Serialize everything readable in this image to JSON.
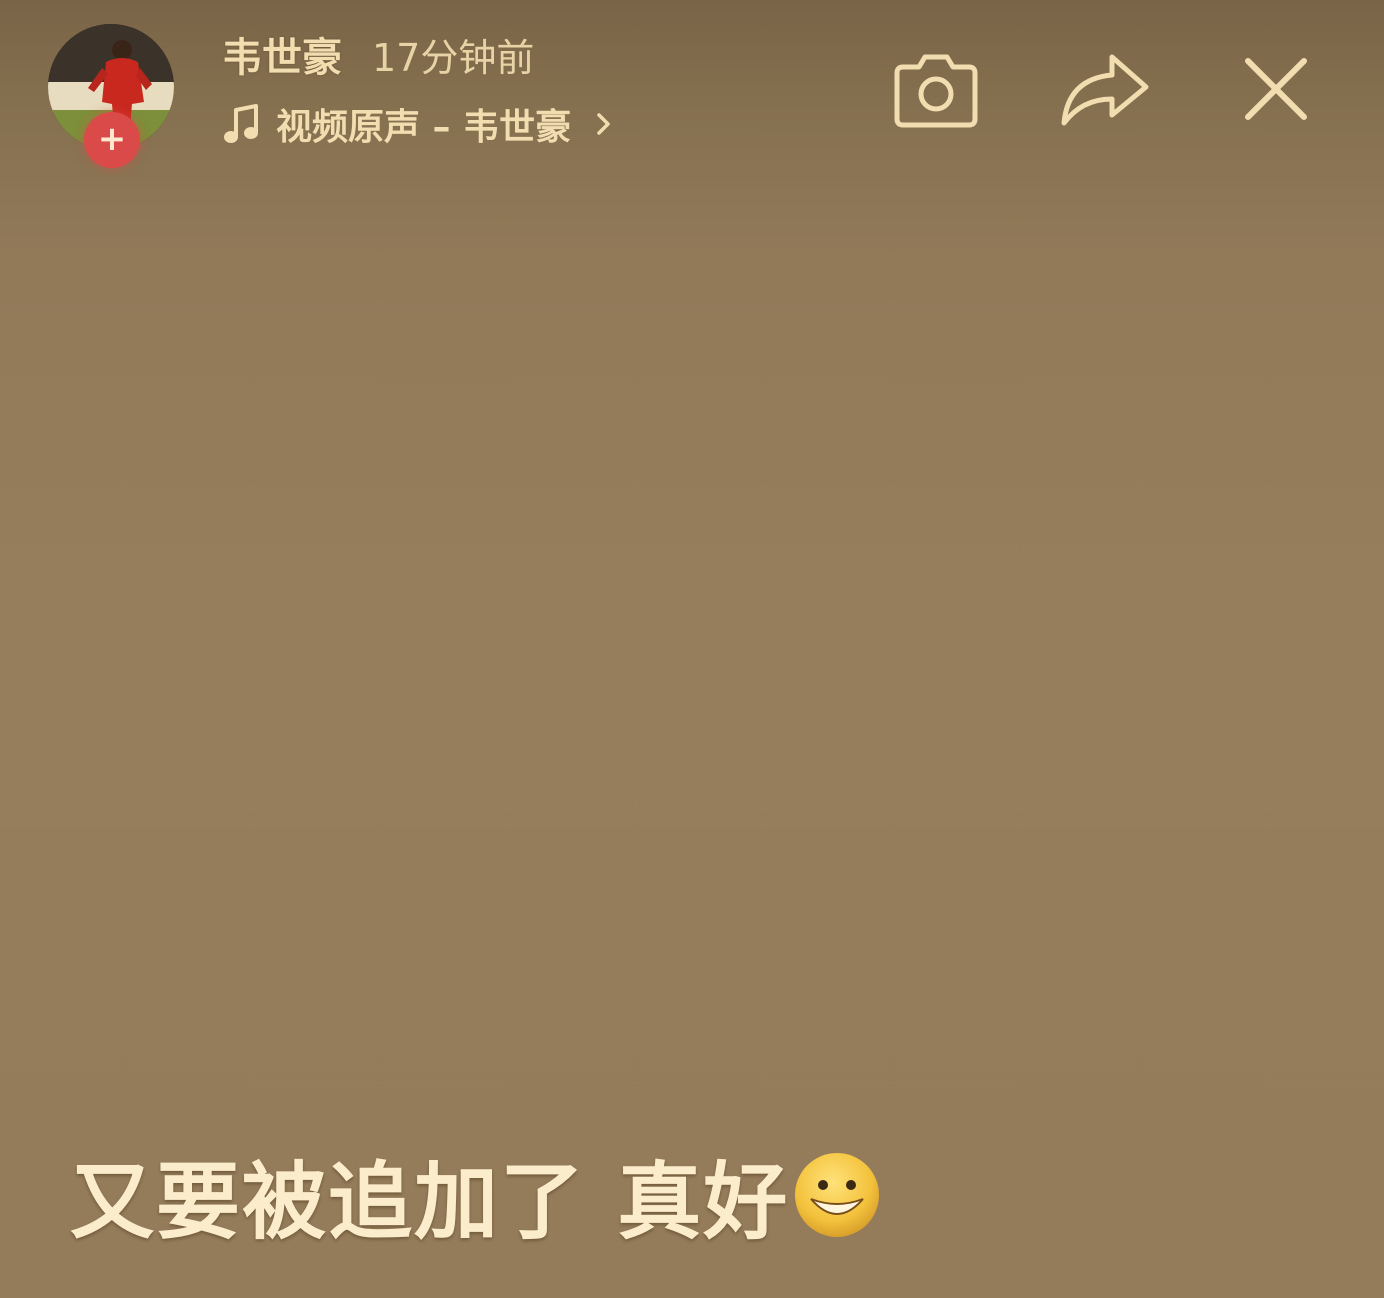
{
  "header": {
    "author_name": "韦世豪",
    "post_time": "17分钟前",
    "follow_badge": "+",
    "music": {
      "icon": "music-note-icon",
      "text": "视频原声 – 韦世豪",
      "chevron": "chevron-right-icon"
    },
    "actions": [
      {
        "name": "camera",
        "icon": "camera-icon"
      },
      {
        "name": "share",
        "icon": "share-arrow-icon"
      },
      {
        "name": "close",
        "icon": "close-icon"
      }
    ]
  },
  "post": {
    "caption": "又要被追加了 真好",
    "emoji": "grinning-face-emoji"
  },
  "colors": {
    "background": "#967e5c",
    "text": "#f1ddb0",
    "caption_text": "#fbeccc",
    "follow_badge": "#d94a48"
  }
}
